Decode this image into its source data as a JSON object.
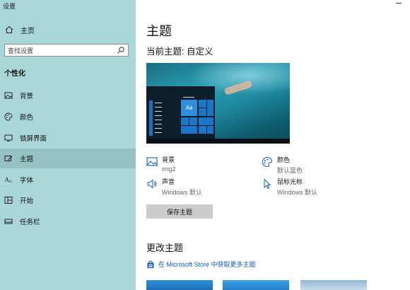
{
  "window": {
    "title": "设置"
  },
  "sidebar": {
    "home_label": "主页",
    "search_placeholder": "查找设置",
    "section_label": "个性化",
    "items": [
      {
        "label": "背景",
        "icon": "picture-icon"
      },
      {
        "label": "颜色",
        "icon": "palette-icon"
      },
      {
        "label": "锁屏界面",
        "icon": "lock-screen-icon"
      },
      {
        "label": "主题",
        "icon": "theme-icon",
        "active": true
      },
      {
        "label": "字体",
        "icon": "font-icon"
      },
      {
        "label": "开始",
        "icon": "start-icon"
      },
      {
        "label": "任务栏",
        "icon": "taskbar-icon"
      }
    ]
  },
  "main": {
    "title": "主题",
    "current_theme": "当前主题: 自定义",
    "preview_tile_text": "Aa",
    "properties": {
      "background": {
        "name": "背景",
        "value": "img2"
      },
      "color": {
        "name": "颜色",
        "value": "默认蓝色"
      },
      "sound": {
        "name": "声音",
        "value": "Windows 默认"
      },
      "cursor": {
        "name": "鼠标光标",
        "value": "Windows 默认"
      }
    },
    "save_button": "保存主题",
    "change_theme_title": "更改主题",
    "store_link": "在 Microsoft Store 中获取更多主题"
  },
  "colors": {
    "sidebar_bg": "#a9d7d8",
    "accent": "#0067c0",
    "link": "#0a5ebd"
  }
}
